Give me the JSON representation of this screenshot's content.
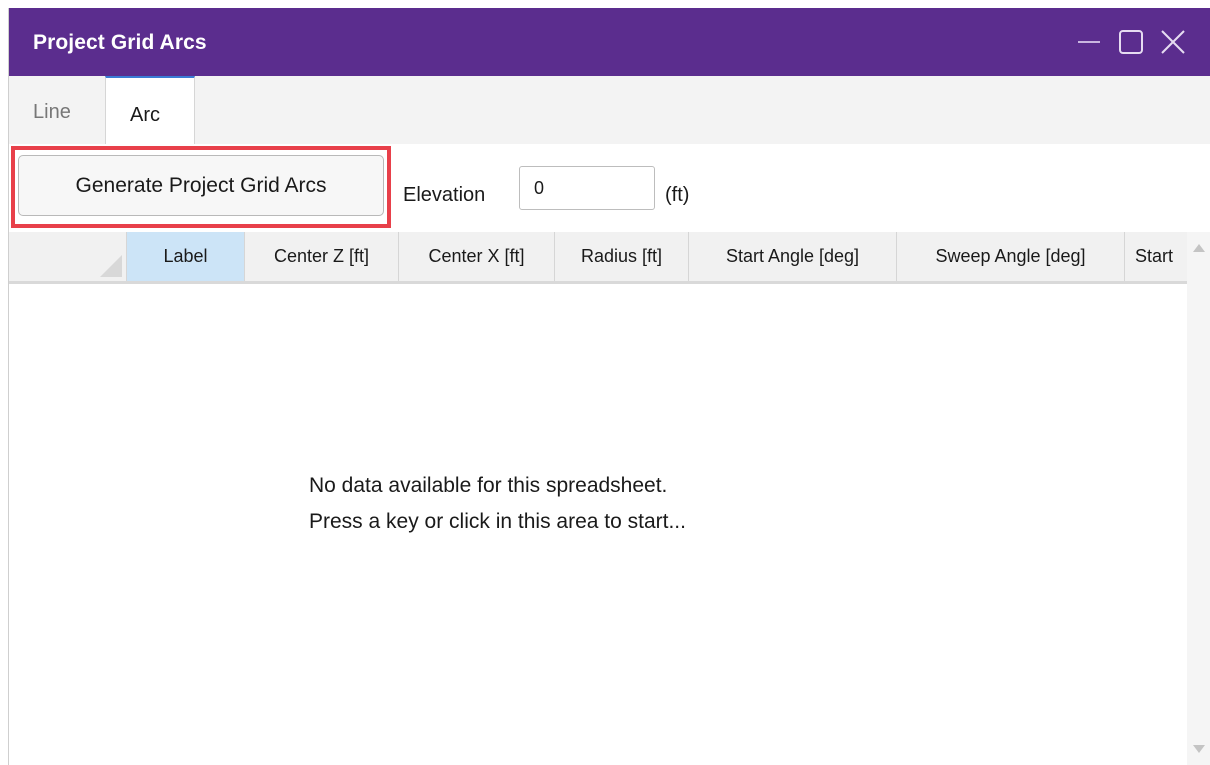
{
  "window": {
    "title": "Project Grid Arcs",
    "controls": [
      "minimize-icon",
      "maximize-icon",
      "close-icon"
    ]
  },
  "tabs": [
    {
      "label": "Line",
      "active": false
    },
    {
      "label": "Arc",
      "active": true
    }
  ],
  "toolbar": {
    "generate_label": "Generate Project Grid Arcs",
    "elevation_label": "Elevation",
    "elevation_value": "0",
    "elevation_unit": "(ft)"
  },
  "grid": {
    "columns": [
      "Label",
      "Center Z [ft]",
      "Center X [ft]",
      "Radius [ft]",
      "Start Angle [deg]",
      "Sweep Angle [deg]",
      "Start"
    ],
    "selected_column": "Label",
    "rows": [],
    "empty_line1": "No data available for this spreadsheet.",
    "empty_line2": "Press a key or click in this area to start..."
  },
  "colors": {
    "titlebar": "#5b2d8e",
    "highlight": "#e8404a",
    "active_tab_accent": "#3a7bd5",
    "selected_header": "#cce4f7"
  }
}
